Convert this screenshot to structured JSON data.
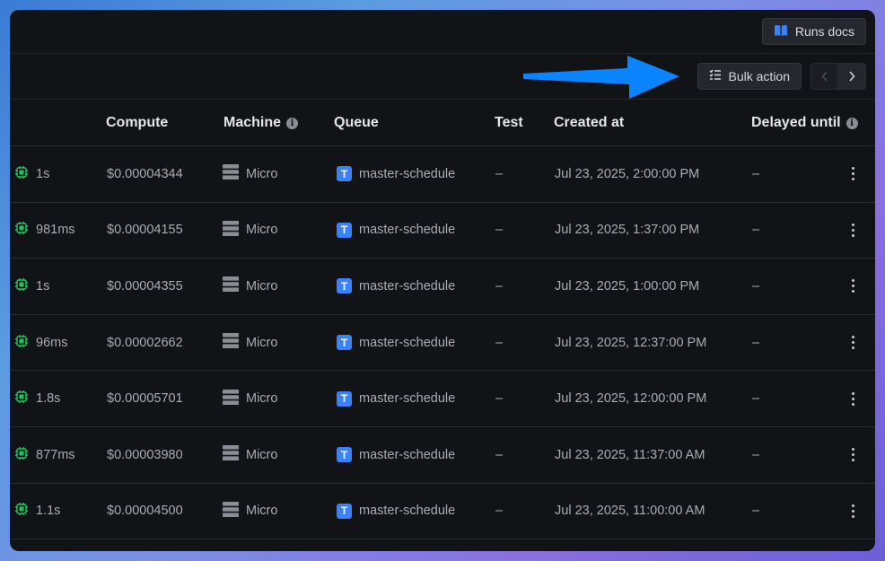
{
  "topbar": {
    "docs_label": "Runs docs"
  },
  "toolbar": {
    "bulk_label": "Bulk action"
  },
  "columns": {
    "compute": "Compute",
    "machine": "Machine",
    "queue": "Queue",
    "test": "Test",
    "created": "Created at",
    "delayed": "Delayed until"
  },
  "rows": [
    {
      "duration": "1s",
      "cost": "$0.00004344",
      "machine": "Micro",
      "queue": "master-schedule",
      "test": "–",
      "created": "Jul 23, 2025, 2:00:00 PM",
      "delayed": "–"
    },
    {
      "duration": "981ms",
      "cost": "$0.00004155",
      "machine": "Micro",
      "queue": "master-schedule",
      "test": "–",
      "created": "Jul 23, 2025, 1:37:00 PM",
      "delayed": "–"
    },
    {
      "duration": "1s",
      "cost": "$0.00004355",
      "machine": "Micro",
      "queue": "master-schedule",
      "test": "–",
      "created": "Jul 23, 2025, 1:00:00 PM",
      "delayed": "–"
    },
    {
      "duration": "96ms",
      "cost": "$0.00002662",
      "machine": "Micro",
      "queue": "master-schedule",
      "test": "–",
      "created": "Jul 23, 2025, 12:37:00 PM",
      "delayed": "–"
    },
    {
      "duration": "1.8s",
      "cost": "$0.00005701",
      "machine": "Micro",
      "queue": "master-schedule",
      "test": "–",
      "created": "Jul 23, 2025, 12:00:00 PM",
      "delayed": "–"
    },
    {
      "duration": "877ms",
      "cost": "$0.00003980",
      "machine": "Micro",
      "queue": "master-schedule",
      "test": "–",
      "created": "Jul 23, 2025, 11:37:00 AM",
      "delayed": "–"
    },
    {
      "duration": "1.1s",
      "cost": "$0.00004500",
      "machine": "Micro",
      "queue": "master-schedule",
      "test": "–",
      "created": "Jul 23, 2025, 11:00:00 AM",
      "delayed": "–"
    }
  ],
  "icons": {
    "queue_badge": "T",
    "info": "i",
    "duration": "cpu-icon",
    "machine": "server-icon",
    "docs": "book-icon",
    "bulk": "checklist-icon"
  },
  "colors": {
    "accent": "#3b82f6",
    "cpu": "#22c55e",
    "arrow": "#0a84ff"
  }
}
